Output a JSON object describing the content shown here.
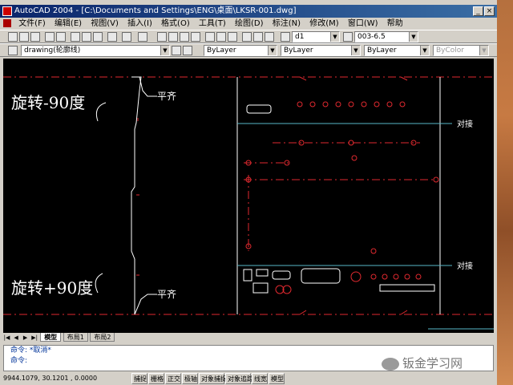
{
  "window": {
    "title": "AutoCAD 2004 - [C:\\Documents and Settings\\ENG\\桌面\\LKSR-001.dwg]"
  },
  "menu": [
    "文件(F)",
    "编辑(E)",
    "视图(V)",
    "插入(I)",
    "格式(O)",
    "工具(T)",
    "绘图(D)",
    "标注(N)",
    "修改(M)",
    "窗口(W)",
    "帮助"
  ],
  "toolbar": {
    "dimstyle": "d1",
    "textstyle": "003-6.5"
  },
  "layers": {
    "current_layer": "drawing(轮廓线)",
    "color": "ByLayer",
    "linetype": "ByLayer",
    "lineweight": "ByLayer",
    "plotstyle": "ByColor"
  },
  "drawing": {
    "rotate_minus": "旋转-90度",
    "rotate_plus": "旋转+90度",
    "align_label": "平齐",
    "butt_label": "对接",
    "colors": {
      "red": "#e0292f",
      "white": "#ffffff",
      "cyan": "#58b8c8"
    }
  },
  "tabs": {
    "model": "模型",
    "layout1": "布局1",
    "layout2": "布局2"
  },
  "command": {
    "line1": "命令: *取消*",
    "line2": "命令:"
  },
  "status": {
    "coords": "9944.1079, 30.1201 , 0.0000",
    "buttons": [
      "捕捉",
      "栅格",
      "正交",
      "极轴",
      "对象捕捉",
      "对象追踪",
      "线宽",
      "模型"
    ]
  },
  "watermark": "钣金学习网"
}
